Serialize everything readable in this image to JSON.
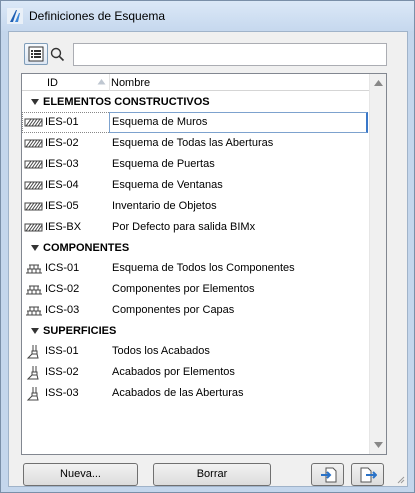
{
  "window": {
    "title": "Definiciones de Esquema"
  },
  "search": {
    "value": "",
    "placeholder": ""
  },
  "list": {
    "header": {
      "id": "ID",
      "name": "Nombre"
    },
    "groups": [
      {
        "label": "ELEMENTOS CONSTRUCTIVOS",
        "icon": "hatch-icon",
        "rows": [
          {
            "id": "IES-01",
            "name": "Esquema de Muros"
          },
          {
            "id": "IES-02",
            "name": "Esquema de Todas las Aberturas"
          },
          {
            "id": "IES-03",
            "name": "Esquema de Puertas"
          },
          {
            "id": "IES-04",
            "name": "Esquema de Ventanas"
          },
          {
            "id": "IES-05",
            "name": "Inventario de Objetos"
          },
          {
            "id": "IES-BX",
            "name": "Por Defecto para salida BIMx"
          }
        ]
      },
      {
        "label": "COMPONENTES",
        "icon": "layers-icon",
        "rows": [
          {
            "id": "ICS-01",
            "name": "Esquema de Todos los Componentes"
          },
          {
            "id": "ICS-02",
            "name": "Componentes por Elementos"
          },
          {
            "id": "ICS-03",
            "name": "Componentes por Capas"
          }
        ]
      },
      {
        "label": "SUPERFICIES",
        "icon": "brush-icon",
        "rows": [
          {
            "id": "ISS-01",
            "name": "Todos los Acabados"
          },
          {
            "id": "ISS-02",
            "name": "Acabados por Elementos"
          },
          {
            "id": "ISS-03",
            "name": "Acabados de las Aberturas"
          }
        ]
      }
    ]
  },
  "buttons": {
    "new": "Nueva...",
    "delete": "Borrar"
  },
  "colors": {
    "accent": "#3a78c9",
    "selection_border": "#7da2ce"
  }
}
